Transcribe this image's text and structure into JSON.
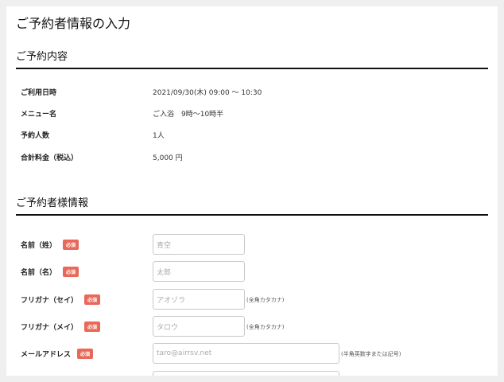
{
  "page_title": "ご予約者情報の入力",
  "reservation": {
    "heading": "ご予約内容",
    "rows": [
      {
        "label": "ご利用日時",
        "value": "2021/09/30(木) 09:00 〜 10:30"
      },
      {
        "label": "メニュー名",
        "value": "ご入浴　9時〜10時半"
      },
      {
        "label": "予約人数",
        "value": "1人"
      },
      {
        "label": "合計料金（税込）",
        "value": "5,000 円"
      }
    ]
  },
  "customer": {
    "heading": "ご予約者様情報",
    "required_badge": "必須",
    "fields": [
      {
        "label": "名前（姓）",
        "placeholder": "青空",
        "note": ""
      },
      {
        "label": "名前（名）",
        "placeholder": "太郎",
        "note": ""
      },
      {
        "label": "フリガナ（セイ）",
        "placeholder": "アオゾラ",
        "note": "(全角カタカナ)"
      },
      {
        "label": "フリガナ（メイ）",
        "placeholder": "タロウ",
        "note": "(全角カタカナ)"
      },
      {
        "label": "メールアドレス",
        "placeholder": "taro@airrsv.net",
        "note": "(半角英数字または記号)"
      }
    ]
  },
  "colors": {
    "required_badge": "#e8695a"
  }
}
